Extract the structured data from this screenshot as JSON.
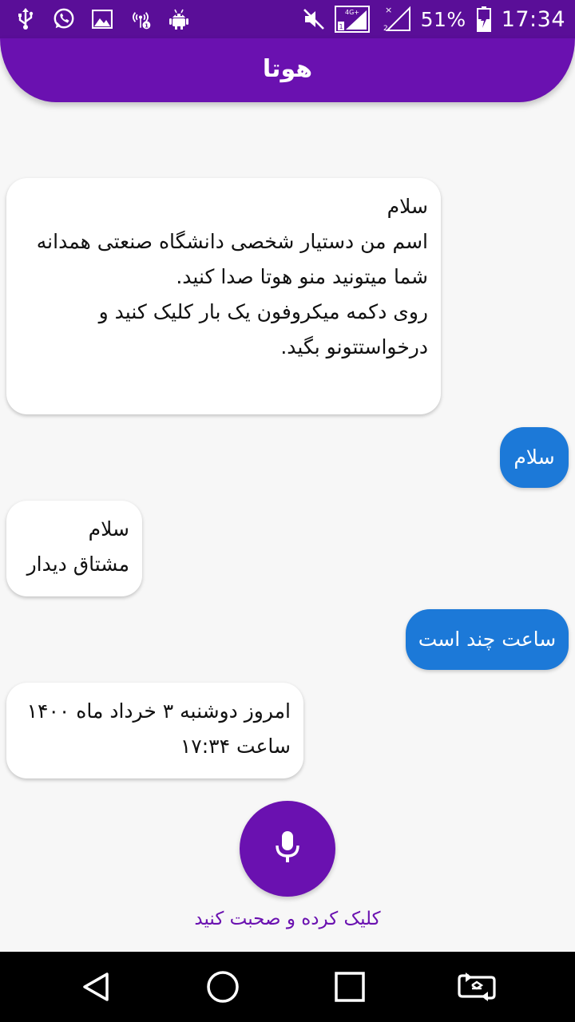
{
  "status_bar": {
    "battery_percent": "51%",
    "time": "17:34",
    "network_label": "4G+",
    "left_icons": [
      "usb-icon",
      "whatsapp-icon",
      "image-icon",
      "hotspot-icon",
      "android-debug-icon"
    ],
    "right_icons": [
      "mute-icon",
      "signal-4g-icon",
      "signal-sim2-icon",
      "battery-icon"
    ]
  },
  "app_bar": {
    "title": "هوتا"
  },
  "chat": {
    "messages": [
      {
        "from": "bot",
        "text": "سلام\nاسم من دستیار شخصی دانشگاه صنعتی همدانه\nشما میتونید منو هوتا صدا کنید.\nروی دکمه میکروفون یک بار کلیک کنید و درخواستتونو بگید."
      },
      {
        "from": "user",
        "text": "سلام"
      },
      {
        "from": "bot",
        "text": "سلام\nمشتاق دیدار"
      },
      {
        "from": "user",
        "text": "ساعت چند است"
      },
      {
        "from": "bot",
        "text": "امروز دوشنبه ۳ خرداد ماه ۱۴۰۰\nساعت ۱۷:۳۴"
      }
    ]
  },
  "mic": {
    "icon": "microphone-icon",
    "hint": "کلیک کرده و صحبت کنید"
  },
  "nav_bar": {
    "buttons": [
      "back-icon",
      "home-icon",
      "recents-icon",
      "screen-rotate-icon"
    ]
  },
  "colors": {
    "status_bar": "#5a0e98",
    "primary": "#6a11b0",
    "user_bubble": "#1c79d8",
    "bot_bubble": "#ffffff",
    "background": "#f7f7f7"
  }
}
